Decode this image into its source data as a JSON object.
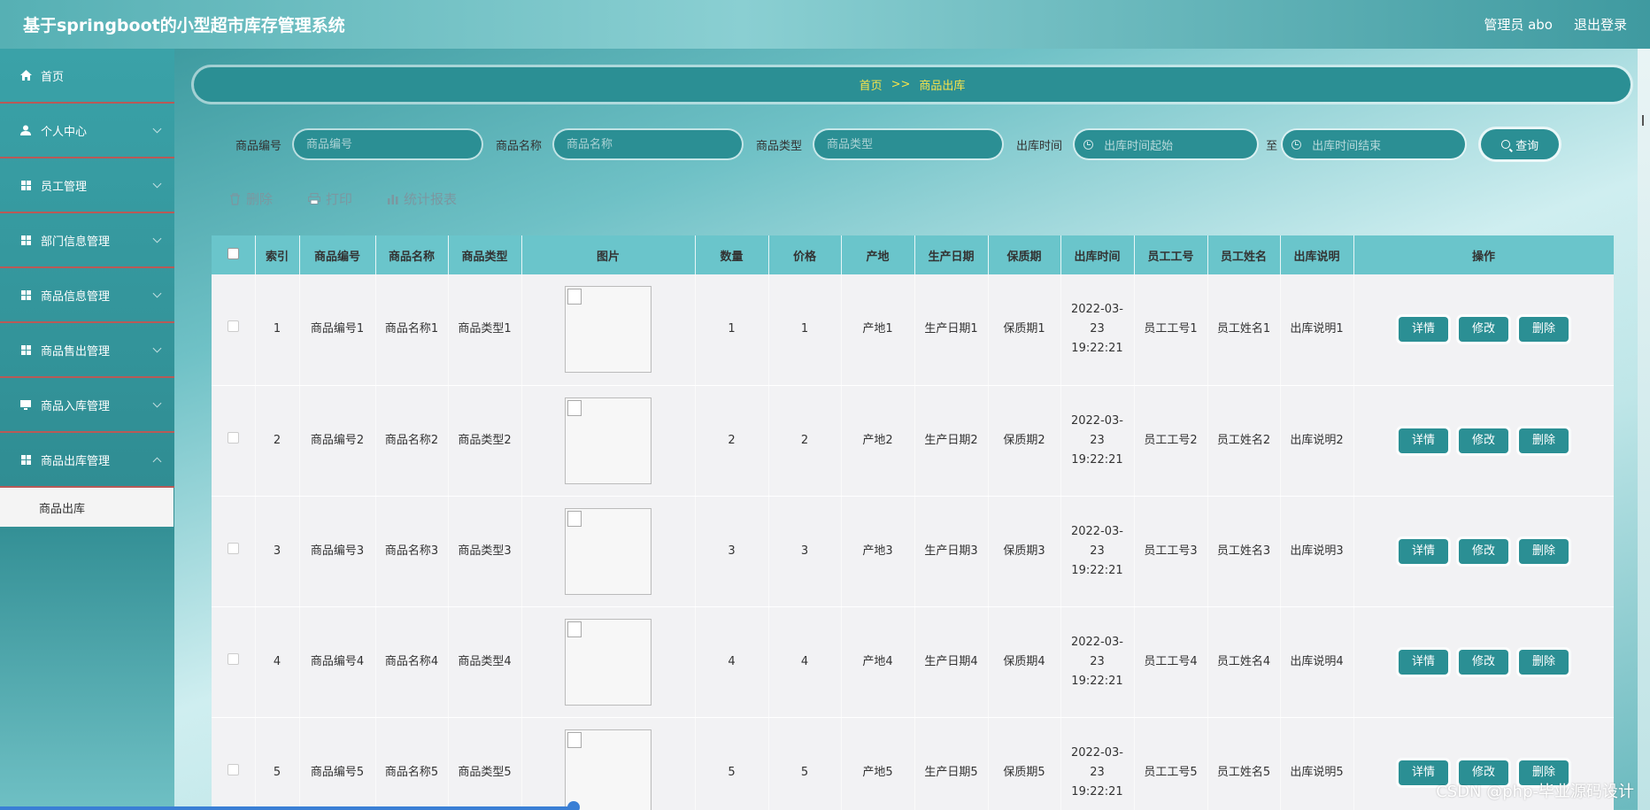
{
  "app": {
    "title": "基于springboot的小型超市库存管理系统",
    "user_label": "管理员 abo",
    "logout_label": "退出登录"
  },
  "sidebar": {
    "items": [
      {
        "label": "首页",
        "icon": "home-icon",
        "has_chevron": false
      },
      {
        "label": "个人中心",
        "icon": "user-icon",
        "has_chevron": true
      },
      {
        "label": "员工管理",
        "icon": "grid-icon",
        "has_chevron": true
      },
      {
        "label": "部门信息管理",
        "icon": "grid-icon",
        "has_chevron": true
      },
      {
        "label": "商品信息管理",
        "icon": "grid-icon",
        "has_chevron": true
      },
      {
        "label": "商品售出管理",
        "icon": "grid-icon",
        "has_chevron": true
      },
      {
        "label": "商品入库管理",
        "icon": "monitor-icon",
        "has_chevron": true
      },
      {
        "label": "商品出库管理",
        "icon": "grid-icon",
        "has_chevron": true
      }
    ],
    "active_submenu": "商品出库"
  },
  "breadcrumb": {
    "home": "首页",
    "separator": ">>",
    "current": "商品出库"
  },
  "search": {
    "code_label": "商品编号",
    "code_placeholder": "商品编号",
    "name_label": "商品名称",
    "name_placeholder": "商品名称",
    "type_label": "商品类型",
    "type_placeholder": "商品类型",
    "time_label": "出库时间",
    "time_start_placeholder": "出库时间起始",
    "time_to": "至",
    "time_end_placeholder": "出库时间结束",
    "query_label": "查询"
  },
  "actions": {
    "delete": "删除",
    "print": "打印",
    "report": "统计报表"
  },
  "table": {
    "columns": [
      "索引",
      "商品编号",
      "商品名称",
      "商品类型",
      "图片",
      "数量",
      "价格",
      "产地",
      "生产日期",
      "保质期",
      "出库时间",
      "员工工号",
      "员工姓名",
      "出库说明",
      "操作"
    ],
    "op_labels": {
      "detail": "详情",
      "edit": "修改",
      "delete": "删除"
    },
    "rows": [
      {
        "index": "1",
        "code": "商品编号1",
        "name": "商品名称1",
        "type": "商品类型1",
        "qty": "1",
        "price": "1",
        "origin": "产地1",
        "mfg": "生产日期1",
        "shelf": "保质期1",
        "time": "2022-03-23 19:22:21",
        "emp_no": "员工工号1",
        "emp_name": "员工姓名1",
        "note": "出库说明1"
      },
      {
        "index": "2",
        "code": "商品编号2",
        "name": "商品名称2",
        "type": "商品类型2",
        "qty": "2",
        "price": "2",
        "origin": "产地2",
        "mfg": "生产日期2",
        "shelf": "保质期2",
        "time": "2022-03-23 19:22:21",
        "emp_no": "员工工号2",
        "emp_name": "员工姓名2",
        "note": "出库说明2"
      },
      {
        "index": "3",
        "code": "商品编号3",
        "name": "商品名称3",
        "type": "商品类型3",
        "qty": "3",
        "price": "3",
        "origin": "产地3",
        "mfg": "生产日期3",
        "shelf": "保质期3",
        "time": "2022-03-23 19:22:21",
        "emp_no": "员工工号3",
        "emp_name": "员工姓名3",
        "note": "出库说明3"
      },
      {
        "index": "4",
        "code": "商品编号4",
        "name": "商品名称4",
        "type": "商品类型4",
        "qty": "4",
        "price": "4",
        "origin": "产地4",
        "mfg": "生产日期4",
        "shelf": "保质期4",
        "time": "2022-03-23 19:22:21",
        "emp_no": "员工工号4",
        "emp_name": "员工姓名4",
        "note": "出库说明4"
      },
      {
        "index": "5",
        "code": "商品编号5",
        "name": "商品名称5",
        "type": "商品类型5",
        "qty": "5",
        "price": "5",
        "origin": "产地5",
        "mfg": "生产日期5",
        "shelf": "保质期5",
        "time": "2022-03-23 19:22:21",
        "emp_no": "员工工号5",
        "emp_name": "员工姓名5",
        "note": "出库说明5"
      }
    ]
  },
  "watermark": "CSDN @php-毕业源码设计"
}
